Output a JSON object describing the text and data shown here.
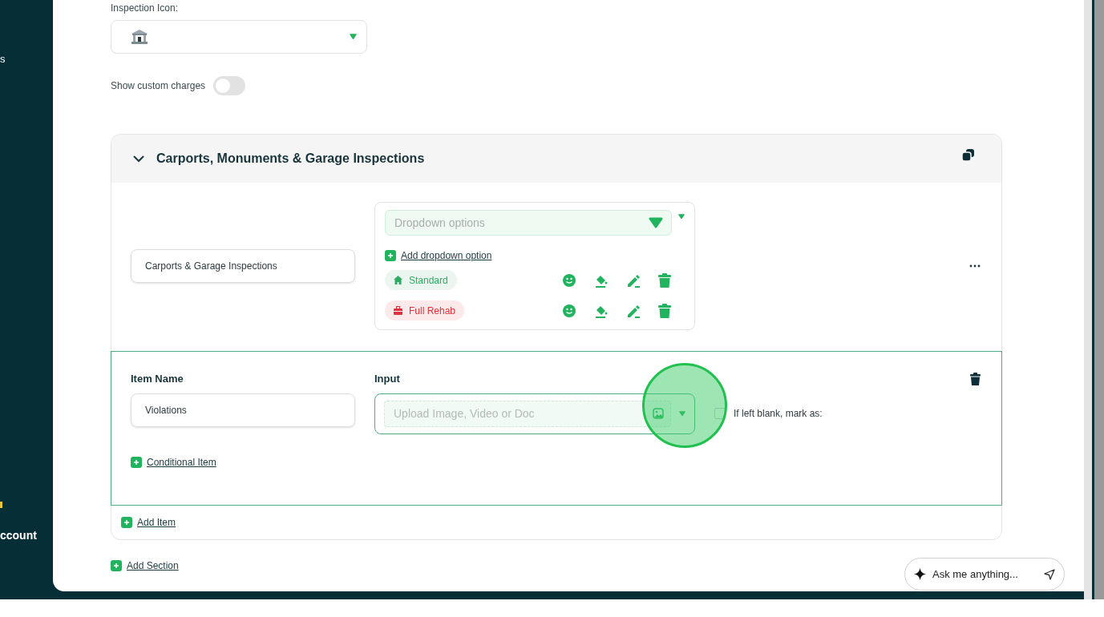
{
  "sidebar": {
    "items": [
      {
        "label": "s"
      },
      {
        "label": "ccount"
      }
    ]
  },
  "inspection_icon": {
    "label": "Inspection Icon:"
  },
  "custom_charges": {
    "label": "Show custom charges",
    "on": false
  },
  "section": {
    "title": "Carports, Monuments & Garage Inspections",
    "expanded": true,
    "field_value": "Carports & Garage Inspections",
    "dropdown": {
      "placeholder": "Dropdown options",
      "add_label": "Add dropdown option",
      "options": [
        {
          "label": "Standard",
          "kind": "home",
          "color": "#2eaa62"
        },
        {
          "label": "Full Rehab",
          "kind": "toolbox",
          "color": "#e0323c"
        }
      ]
    },
    "item": {
      "name_label": "Item Name",
      "name_value": "Violations",
      "input_label": "Input",
      "input_placeholder": "Upload Image, Video or Doc",
      "blank_label": "If left blank, mark as:",
      "blank_checked": false,
      "conditional_label": "Conditional Item"
    },
    "add_item": "Add Item"
  },
  "add_section": "Add Section",
  "assistant": {
    "placeholder": "Ask me anything..."
  }
}
